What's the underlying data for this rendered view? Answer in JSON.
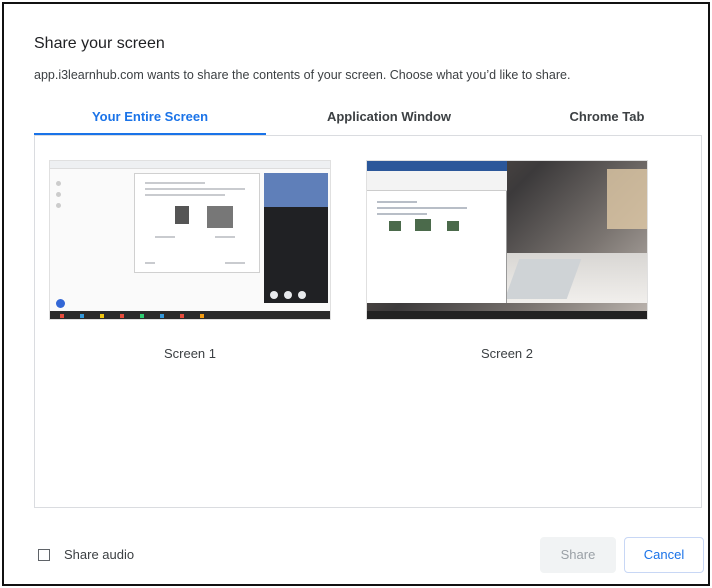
{
  "dialog": {
    "title": "Share your screen",
    "subtitle": "app.i3learnhub.com wants to share the contents of your screen. Choose what you’d like to share."
  },
  "tabs": [
    {
      "label": "Your Entire Screen",
      "active": true
    },
    {
      "label": "Application Window",
      "active": false
    },
    {
      "label": "Chrome Tab",
      "active": false
    }
  ],
  "screens": [
    {
      "label": "Screen 1"
    },
    {
      "label": "Screen 2"
    }
  ],
  "footer": {
    "share_audio_label": "Share audio",
    "share_audio_checked": false,
    "share_button": "Share",
    "cancel_button": "Cancel"
  },
  "colors": {
    "accent": "#1a73e8",
    "text_primary": "#202124",
    "text_secondary": "#3c4043",
    "divider": "#dadce0",
    "disabled_bg": "#f1f3f4",
    "disabled_text": "#9aa0a6"
  }
}
